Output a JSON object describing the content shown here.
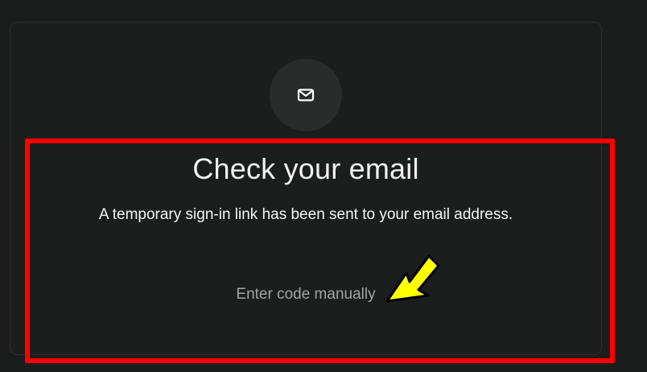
{
  "icon": {
    "name": "mail-icon",
    "color": "#ffffff"
  },
  "content": {
    "title": "Check your email",
    "subtitle": "A temporary sign-in link has been sent to your email address.",
    "manual_link": "Enter code manually"
  },
  "annotation": {
    "highlight_color": "#ff0000",
    "arrow_color": "#ffff00"
  }
}
